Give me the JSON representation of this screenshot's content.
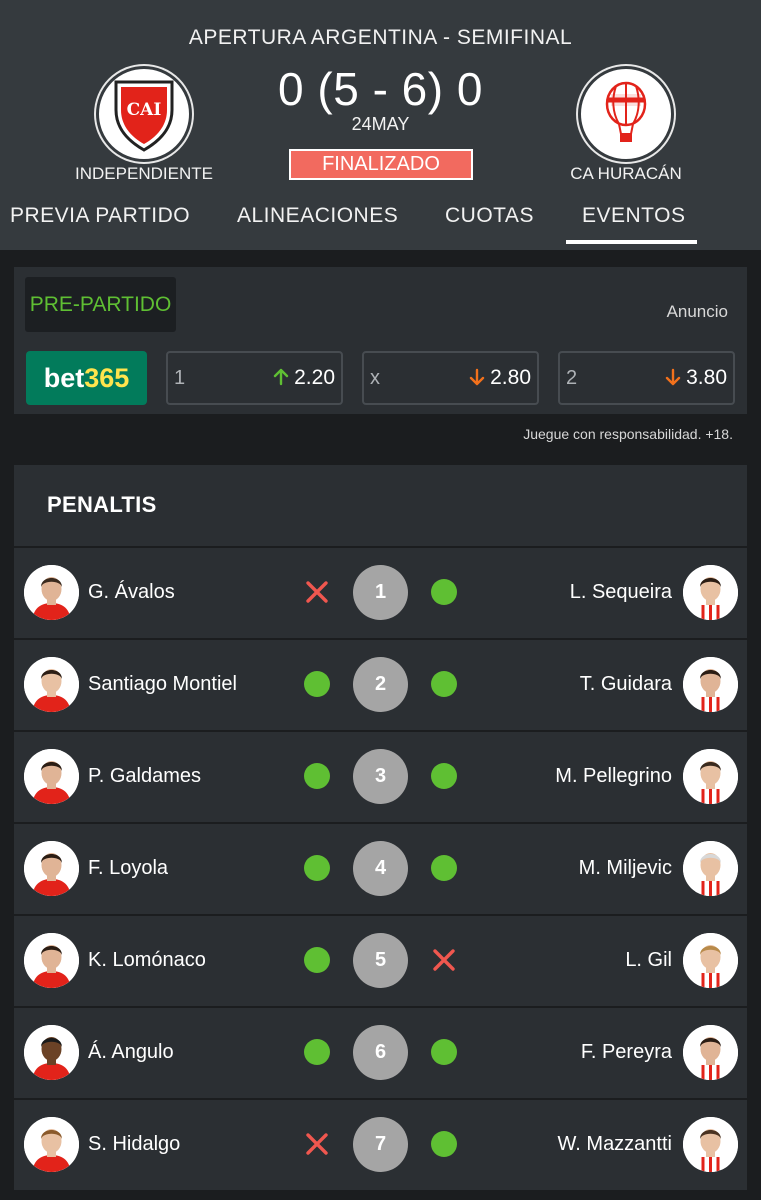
{
  "match": {
    "competition": "APERTURA ARGENTINA - SEMIFINAL",
    "score": "0 (5 - 6) 0",
    "date": "24MAY",
    "status": "FINALIZADO",
    "home_team": "INDEPENDIENTE",
    "away_team": "CA HURACÁN",
    "home_logo_text": "CAI"
  },
  "tabs": [
    "PREVIA PARTIDO",
    "ALINEACIONES",
    "CUOTAS",
    "EVENTOS"
  ],
  "active_tab": "EVENTOS",
  "odds": {
    "section_label": "PRE-PARTIDO",
    "ad_label": "Anuncio",
    "bookmaker_part1": "bet",
    "bookmaker_part2": "365",
    "items": [
      {
        "label": "1",
        "value": "2.20",
        "trend": "up"
      },
      {
        "label": "x",
        "value": "2.80",
        "trend": "down"
      },
      {
        "label": "2",
        "value": "3.80",
        "trend": "down"
      }
    ],
    "responsible": "Juegue con responsabilidad. +18."
  },
  "penalties": {
    "title": "PENALTIS",
    "rows": [
      {
        "n": "1",
        "home": "G. Ávalos",
        "home_result": "miss",
        "away": "L. Sequeira",
        "away_result": "goal"
      },
      {
        "n": "2",
        "home": "Santiago Montiel",
        "home_result": "goal",
        "away": "T. Guidara",
        "away_result": "goal"
      },
      {
        "n": "3",
        "home": "P. Galdames",
        "home_result": "goal",
        "away": "M. Pellegrino",
        "away_result": "goal"
      },
      {
        "n": "4",
        "home": "F. Loyola",
        "home_result": "goal",
        "away": "M. Miljevic",
        "away_result": "goal"
      },
      {
        "n": "5",
        "home": "K. Lomónaco",
        "home_result": "goal",
        "away": "L. Gil",
        "away_result": "miss"
      },
      {
        "n": "6",
        "home": "Á. Angulo",
        "home_result": "goal",
        "away": "F. Pereyra",
        "away_result": "goal"
      },
      {
        "n": "7",
        "home": "S. Hidalgo",
        "home_result": "miss",
        "away": "W. Mazzantti",
        "away_result": "goal"
      }
    ]
  },
  "colors": {
    "header_bg": "#353a3e",
    "card_bg": "#2b2f33",
    "goal": "#5fbf33",
    "miss": "#f0574f",
    "up": "#5fbf33",
    "down": "#f2711c",
    "status_bg": "#f26a5f",
    "independiente_red": "#e2231a",
    "huracan_red": "#e2231a"
  }
}
